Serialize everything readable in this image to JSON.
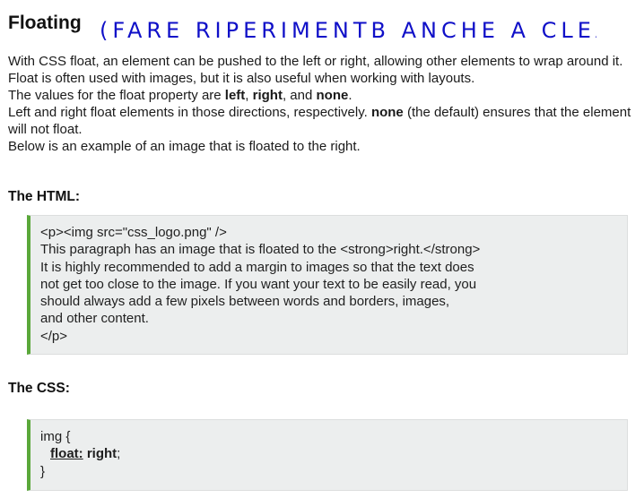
{
  "header": {
    "title": "Floating",
    "handwritten_note": "(FARE RIPERIMENTB ANCHE A CLEAR)"
  },
  "intro": {
    "line1": "With CSS float, an element can be pushed to the left or right, allowing other elements to wrap around it.",
    "line2": "Float is often used with images, but it is also useful when working with layouts.",
    "line3_prefix": "The values for the float property are ",
    "line3_v1": "left",
    "line3_sep1": ", ",
    "line3_v2": "right",
    "line3_sep2": ", and ",
    "line3_v3": "none",
    "line3_suffix": ".",
    "line4_prefix": "Left and right float elements in those directions, respectively. ",
    "line4_bold": "none",
    "line4_suffix": " (the default) ensures that the element will not float.",
    "line5": "Below is an example of an image that is floated to the right."
  },
  "html_section": {
    "heading": "The HTML:",
    "lines": [
      "<p><img src=\"css_logo.png\" />",
      "This paragraph has an image that is floated to the <strong>right.</strong>",
      "It is highly recommended to add a margin to images so that the text does",
      "not get too close to the image. If you want your text to be easily read, you",
      "should always add a few pixels between words and borders, images,",
      "and other content.",
      "</p>"
    ]
  },
  "css_section": {
    "heading": "The CSS:",
    "open": "img {",
    "property": "float:",
    "value": "right",
    "terminator": ";",
    "close": "}"
  },
  "colors": {
    "accent_border": "#5aa83a",
    "code_background": "#eceeee",
    "handwriting_ink": "#1010c8"
  }
}
